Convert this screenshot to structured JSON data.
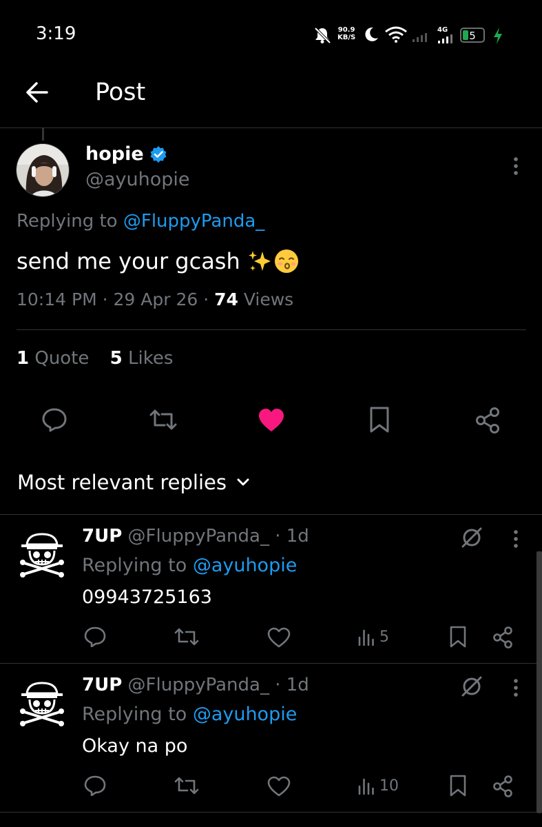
{
  "status_bar": {
    "time": "3:19",
    "speed_value": "90.9",
    "speed_unit": "KB/S",
    "network": "4G",
    "battery": "5"
  },
  "header": {
    "title": "Post"
  },
  "post": {
    "display_name": "hopie",
    "handle": "@ayuhopie",
    "replying_prefix": "Replying to",
    "replying_to": "@FluppyPanda_",
    "text": "send me your gcash",
    "emoji": "✨😙",
    "time": "10:14 PM",
    "date": "29 Apr 26",
    "views_count": "74",
    "views_label": "Views",
    "quotes_count": "1",
    "quotes_label": "Quote",
    "likes_count": "5",
    "likes_label": "Likes"
  },
  "replies_sort": {
    "label": "Most relevant replies"
  },
  "replies": [
    {
      "name": "7UP",
      "handle": "@FluppyPanda_",
      "age": "· 1d",
      "replying_prefix": "Replying to",
      "replying_to": "@ayuhopie",
      "text": "09943725163",
      "views": "5"
    },
    {
      "name": "7UP",
      "handle": "@FluppyPanda_",
      "age": "· 1d",
      "replying_prefix": "Replying to",
      "replying_to": "@ayuhopie",
      "text": "Okay na po",
      "views": "10"
    }
  ],
  "colors": {
    "background": "#000000",
    "link": "#1d9bf0",
    "like": "#f91880",
    "muted": "#71767b",
    "divider": "#2f3336",
    "verified": "#1d9bf0"
  },
  "icons": {
    "back": "arrow-left-icon",
    "more": "more-vertical-icon",
    "reply": "reply-icon",
    "retweet": "retweet-icon",
    "like": "heart-icon",
    "bookmark": "bookmark-icon",
    "share": "share-icon",
    "views": "views-icon",
    "grok": "grok-icon"
  }
}
